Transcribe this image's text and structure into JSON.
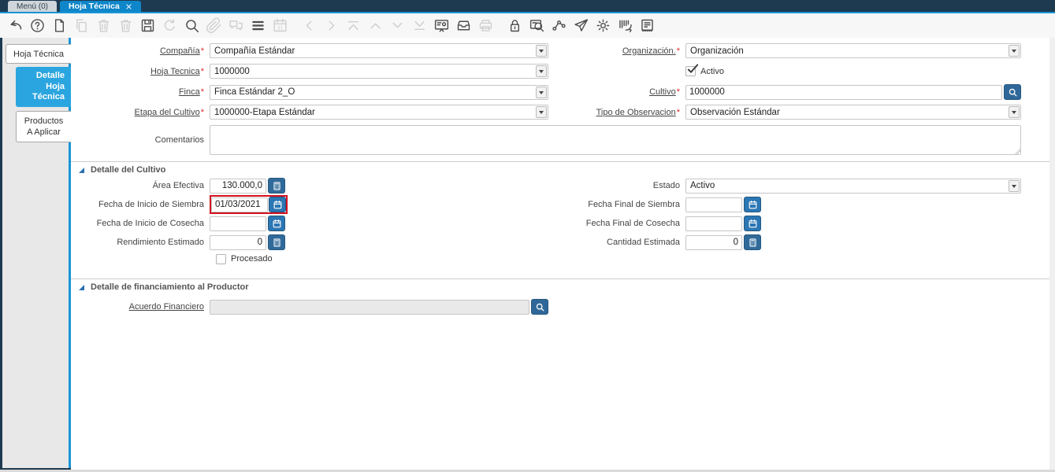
{
  "window_tabs": [
    {
      "label": "Menú (0)"
    },
    {
      "label": "Hoja Técnica"
    }
  ],
  "toolbar": {
    "icons": [
      {
        "name": "undo",
        "enabled": true
      },
      {
        "name": "help",
        "enabled": true
      },
      {
        "name": "new",
        "enabled": true
      },
      {
        "name": "copy",
        "enabled": false
      },
      {
        "name": "delete",
        "enabled": false
      },
      {
        "name": "delete-selection",
        "icon": "delete",
        "enabled": false
      },
      {
        "name": "save",
        "enabled": true
      },
      {
        "name": "refresh",
        "enabled": false
      },
      {
        "name": "find",
        "enabled": true
      },
      {
        "name": "attachment",
        "enabled": false
      },
      {
        "name": "chat",
        "enabled": false
      },
      {
        "name": "grid-toggle",
        "enabled": true
      },
      {
        "name": "calendar",
        "enabled": false
      },
      {
        "name": "chevron-left",
        "enabled": false,
        "gap": true
      },
      {
        "name": "chevron-right",
        "enabled": false
      },
      {
        "name": "first-record",
        "icon": "first",
        "enabled": false
      },
      {
        "name": "previous-record",
        "icon": "up",
        "enabled": false
      },
      {
        "name": "next-record",
        "icon": "down",
        "enabled": false
      },
      {
        "name": "last-record",
        "icon": "last",
        "enabled": false
      },
      {
        "name": "presentation",
        "enabled": true
      },
      {
        "name": "archive",
        "enabled": true
      },
      {
        "name": "print",
        "enabled": false
      },
      {
        "name": "lock",
        "enabled": true,
        "gap": true
      },
      {
        "name": "zoom-search",
        "enabled": true
      },
      {
        "name": "workflow",
        "enabled": true
      },
      {
        "name": "send",
        "enabled": true
      },
      {
        "name": "settings",
        "enabled": true
      },
      {
        "name": "barcode-scan",
        "enabled": true
      },
      {
        "name": "report-document",
        "enabled": true
      }
    ]
  },
  "sidebar_tabs": [
    {
      "label": "Hoja Técnica"
    },
    {
      "label": "Detalle Hoja Técnica"
    },
    {
      "label": "Productos A Aplicar"
    }
  ],
  "form": {
    "compania": {
      "label": "Compañía",
      "req": "*",
      "value": "Compañía Estándar"
    },
    "organizacion": {
      "label": "Organización.",
      "req": "*",
      "value": "Organización"
    },
    "hoja_tecnica": {
      "label": "Hoja Tecnica",
      "req": "*",
      "value": "1000000"
    },
    "activo": {
      "label": "Activo",
      "checked": true
    },
    "finca": {
      "label": "Finca",
      "req": "*",
      "value": "Finca Estándar 2_O"
    },
    "cultivo": {
      "label": "Cultivo",
      "req": "*",
      "value": "1000000"
    },
    "etapa": {
      "label": "Etapa del Cultivo",
      "req": "*",
      "value": "1000000-Etapa Estándar"
    },
    "tipo_obs": {
      "label": "Tipo de Observacion",
      "req": "*",
      "value": "Observación Estándar"
    },
    "comentarios": {
      "label": "Comentarios",
      "value": ""
    }
  },
  "detalle_cultivo": {
    "title": "Detalle del Cultivo",
    "area": {
      "label": "Área Efectiva",
      "value": "130.000,0"
    },
    "estado": {
      "label": "Estado",
      "value": "Activo"
    },
    "f_inicio_siembra": {
      "label": "Fecha de Inicio de Siembra",
      "value": "01/03/2021",
      "highlighted": true
    },
    "f_final_siembra": {
      "label": "Fecha Final de Siembra",
      "value": ""
    },
    "f_inicio_cosecha": {
      "label": "Fecha de Inicio de Cosecha",
      "value": ""
    },
    "f_final_cosecha": {
      "label": "Fecha Final de Cosecha",
      "value": ""
    },
    "rendimiento": {
      "label": "Rendimiento Estimado",
      "value": "0"
    },
    "cantidad": {
      "label": "Cantidad Estimada",
      "value": "0"
    },
    "procesado": {
      "label": "Procesado",
      "checked": false
    }
  },
  "financiamiento": {
    "title": "Detalle de financiamiento al Productor",
    "acuerdo": {
      "label": "Acuerdo Financiero",
      "value": ""
    }
  },
  "colors": {
    "topbar": "#1d3a50",
    "active_window_tab": "#0e86c9",
    "accent_line": "#1995d6",
    "sidebar_active_tab": "#2aa5df",
    "button_blue": "#2f6898",
    "highlight_red": "#d40f20",
    "required_red": "#e0262c"
  }
}
